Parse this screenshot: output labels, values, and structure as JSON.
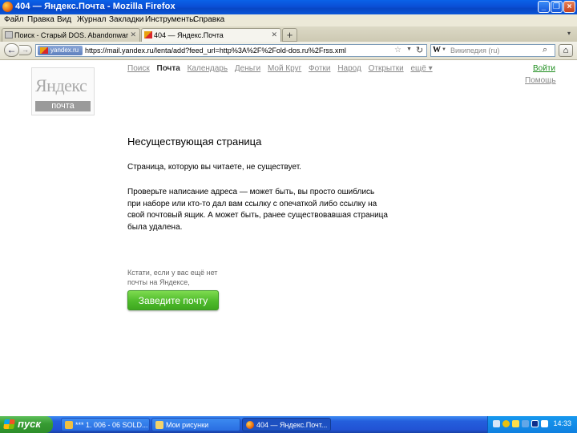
{
  "window": {
    "title": "404 — Яндекс.Почта - Mozilla Firefox"
  },
  "menu": [
    "Файл",
    "Правка",
    "Вид",
    "Журнал",
    "Закладки",
    "Инструменты",
    "Справка"
  ],
  "tabs": [
    {
      "label": "Поиск - Старый DOS. Abandonware, ст...",
      "active": false
    },
    {
      "label": "404 — Яндекс.Почта",
      "active": true
    }
  ],
  "navbar": {
    "site_badge": "yandex.ru",
    "url": "https://mail.yandex.ru/lenta/add?feed_url=http%3A%2F%2Fold-dos.ru%2Frss.xml",
    "search_engine_icon": "W",
    "search_placeholder": "Википедия (ru)"
  },
  "page": {
    "logo_text": "Яндекс",
    "logo_sub": "почта",
    "nav": [
      "Поиск",
      "Почта",
      "Календарь",
      "Деньги",
      "Мой Круг",
      "Фотки",
      "Народ",
      "Открытки",
      "ещё ▾"
    ],
    "login": "Войти",
    "help": "Помощь",
    "title": "Несуществующая страница",
    "para1": "Страница, которую вы читаете, не существует.",
    "para2_lines": [
      "Проверьте написание адреса — может быть, вы просто ошиблись",
      "при наборе или кто-то дал вам ссылку с опечаткой либо ссылку на",
      "свой почтовый ящик. А может быть, ранее существовавшая страница",
      "была удалена."
    ],
    "small_lines": [
      "Кстати, если у вас ещё нет",
      "почты на Яндексе,"
    ],
    "cta": "Заведите почту"
  },
  "taskbar": {
    "start": "пуск",
    "items": [
      {
        "label": "*** 1. 006 - 06 SOLD...",
        "active": false
      },
      {
        "label": "Мои рисунки",
        "active": false
      },
      {
        "label": "404 — Яндекс.Почт...",
        "active": true
      }
    ],
    "clock": "14:33"
  },
  "colors": {
    "accent_green": "#4fbb2c",
    "link_gray": "#888888",
    "xp_blue": "#245edc"
  }
}
